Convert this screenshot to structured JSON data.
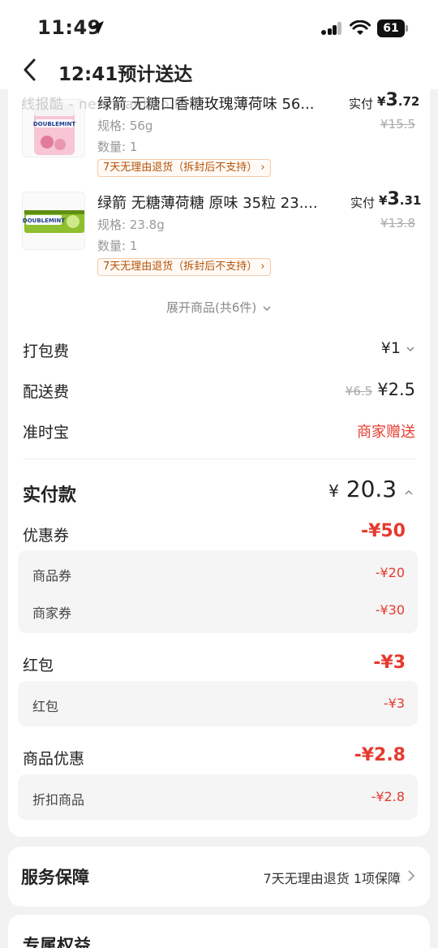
{
  "status_bar": {
    "time": "11:49",
    "battery": "61"
  },
  "header": {
    "title": "12:41预计送达"
  },
  "watermark": "线报酷 - new.xianbao.fun",
  "products": [
    {
      "name": "绿箭 无糖口香糖玫瑰薄荷味 56...",
      "spec": "规格: 56g",
      "qty": "数量: 1",
      "badge": "7天无理由退货（拆封后不支持）",
      "paid_label": "实付",
      "paid_currency": "¥",
      "paid_int": "3",
      "paid_dec": ".72",
      "original": "¥15.5",
      "brand_image_text": "DOUBLEMINT"
    },
    {
      "name": "绿箭 无糖薄荷糖 原味 35粒 23....",
      "spec": "规格: 23.8g",
      "qty": "数量: 1",
      "badge": "7天无理由退货（拆封后不支持）",
      "paid_label": "实付",
      "paid_currency": "¥",
      "paid_int": "3",
      "paid_dec": ".31",
      "original": "¥13.8",
      "brand_image_text": "DOUBLEMINT"
    }
  ],
  "expand_label": "展开商品(共6件)",
  "fees": {
    "packing": {
      "label": "打包费",
      "value": "¥1"
    },
    "delivery": {
      "label": "配送费",
      "original": "¥6.5",
      "value": "¥2.5"
    },
    "ontime": {
      "label": "准时宝",
      "value": "商家赠送"
    }
  },
  "total": {
    "label": "实付款",
    "currency": "¥",
    "value": "20.3"
  },
  "discounts": [
    {
      "label": "优惠券",
      "value": "-¥50",
      "items": [
        {
          "label": "商品券",
          "value": "-¥20"
        },
        {
          "label": "商家券",
          "value": "-¥30"
        }
      ]
    },
    {
      "label": "红包",
      "value": "-¥3",
      "items": [
        {
          "label": "红包",
          "value": "-¥3"
        }
      ]
    },
    {
      "label": "商品优惠",
      "value": "-¥2.8",
      "items": [
        {
          "label": "折扣商品",
          "value": "-¥2.8"
        }
      ]
    }
  ],
  "service": {
    "label": "服务保障",
    "detail": "7天无理由退货 1项保障"
  },
  "rights": {
    "label": "专属权益"
  },
  "colors": {
    "accent_red": "#e63a2e",
    "badge_text": "#b45309"
  }
}
